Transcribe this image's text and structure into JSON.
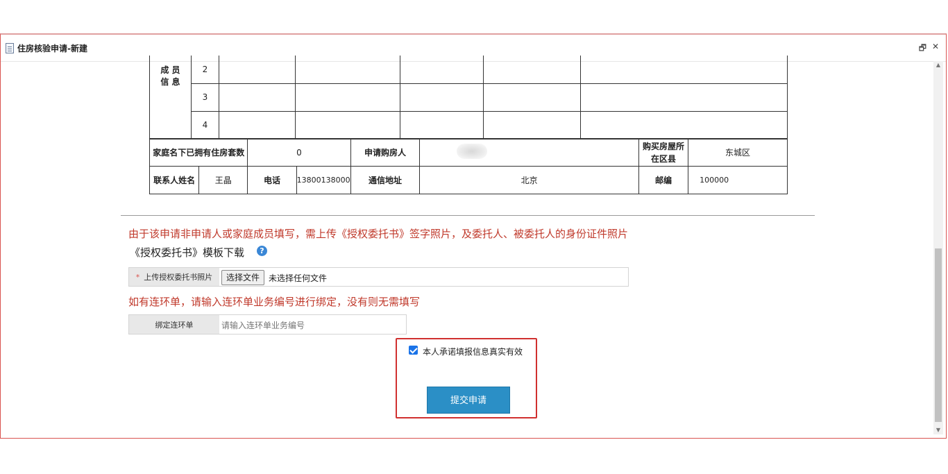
{
  "window": {
    "title": "住房核验申请-新建",
    "restore_icon": "restore-icon",
    "close_icon": "close-icon"
  },
  "members": {
    "section_label_line1": "成  员",
    "section_label_line2": "信  息",
    "rows": [
      "2",
      "3",
      "4"
    ]
  },
  "info_row1": {
    "owned_count_label": "家庭名下已拥有住房套数",
    "owned_count_value": "0",
    "applicant_label": "申请购房人",
    "district_label": "购买房屋所在区县",
    "district_value": "东城区"
  },
  "info_row2": {
    "contact_name_label": "联系人姓名",
    "contact_name_value": "王晶",
    "phone_label": "电话",
    "phone_value": "13800138000",
    "address_label": "通信地址",
    "address_value": "北京",
    "postcode_label": "邮编",
    "postcode_value": "100000"
  },
  "notes": {
    "authorization_notice": "由于该申请非申请人或家庭成员填写，需上传《授权委托书》签字照片，及委托人、被委托人的身份证件照片",
    "template_download": "《授权委托书》模板下载",
    "chain_notice": "如有连环单，请输入连环单业务编号进行绑定，没有则无需填写"
  },
  "upload": {
    "required_mark": "*",
    "label": "上传授权委托书照片",
    "choose_button": "选择文件",
    "status": "未选择任何文件"
  },
  "chain": {
    "label": "绑定连环单",
    "placeholder": "请输入连环单业务编号"
  },
  "commitment": {
    "checked": true,
    "label": "本人承诺填报信息真实有效"
  },
  "submit": {
    "label": "提交申请"
  },
  "colors": {
    "notice_red": "#c0392b",
    "submit_blue": "#2b8fc6",
    "highlight_red": "#d0302f"
  }
}
